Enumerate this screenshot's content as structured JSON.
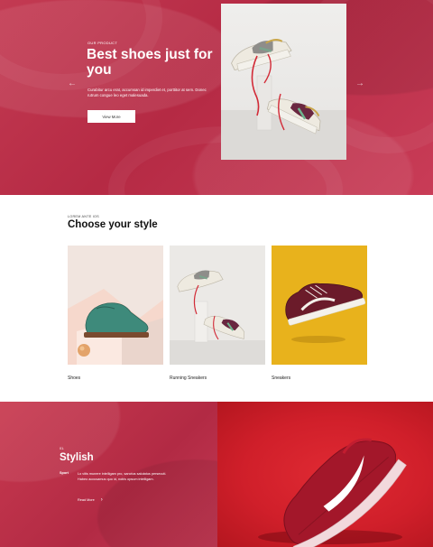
{
  "hero": {
    "eyebrow": "OUR PRODUCT",
    "title": "Best shoes just for you",
    "description": "Curabitur arcu erat, accumsan id imperdiet et, porttitor at sem. Donec rutrum congue leo eget malesuada.",
    "button_label": "View More",
    "prev_icon": "arrow-left-icon",
    "next_icon": "arrow-right-icon"
  },
  "style_section": {
    "eyebrow": "LOREM ANTE IOS",
    "title": "Choose your style",
    "cards": [
      {
        "label": "Shoes"
      },
      {
        "label": "Running Sneakers"
      },
      {
        "label": "Sneakers"
      }
    ]
  },
  "feature": {
    "number": "01.",
    "title": "Stylish",
    "tag": "Sport",
    "description": "Lo vitis munere intelligam pro, sanctus salutatus persecuti. Habeo accusamus quo id, nobis opsum intelligam.",
    "read_more": "Read More"
  },
  "colors": {
    "hero_red": "#c33a52",
    "accent_red": "#d01f2a",
    "mustard": "#e8b21c"
  }
}
